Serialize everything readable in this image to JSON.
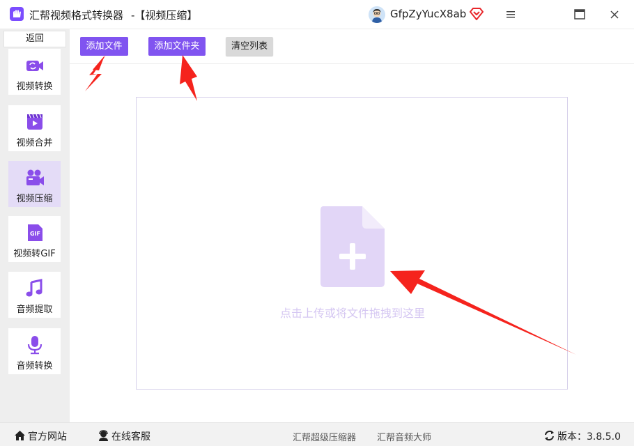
{
  "window": {
    "app_title": "汇帮视频格式转换器",
    "page_subtitle": "-【视频压缩】",
    "username": "GfpZyYucX8ab"
  },
  "sidebar": {
    "back_label": "返回",
    "items": [
      {
        "label": "视频转换",
        "icon": "video-convert-icon",
        "active": false
      },
      {
        "label": "视频合并",
        "icon": "video-merge-icon",
        "active": false
      },
      {
        "label": "视频压缩",
        "icon": "video-compress-icon",
        "active": true
      },
      {
        "label": "视频转GIF",
        "icon": "gif-icon",
        "active": false
      },
      {
        "label": "音频提取",
        "icon": "music-note-icon",
        "active": false
      },
      {
        "label": "音频转换",
        "icon": "microphone-icon",
        "active": false
      }
    ]
  },
  "toolbar": {
    "add_file_label": "添加文件",
    "add_folder_label": "添加文件夹",
    "clear_list_label": "清空列表"
  },
  "drop_zone": {
    "hint": "点击上传或将文件拖拽到这里"
  },
  "footer": {
    "official_site": "官方网站",
    "online_support": "在线客服",
    "compressor_link": "汇帮超级压缩器",
    "audio_link": "汇帮音频大师",
    "version": "版本：3.8.5.0"
  },
  "colors": {
    "accent": "#8054f0",
    "active_nav": "#e4dcf7",
    "arrow": "#f5231d",
    "upload_icon": "#e2d6f7"
  }
}
